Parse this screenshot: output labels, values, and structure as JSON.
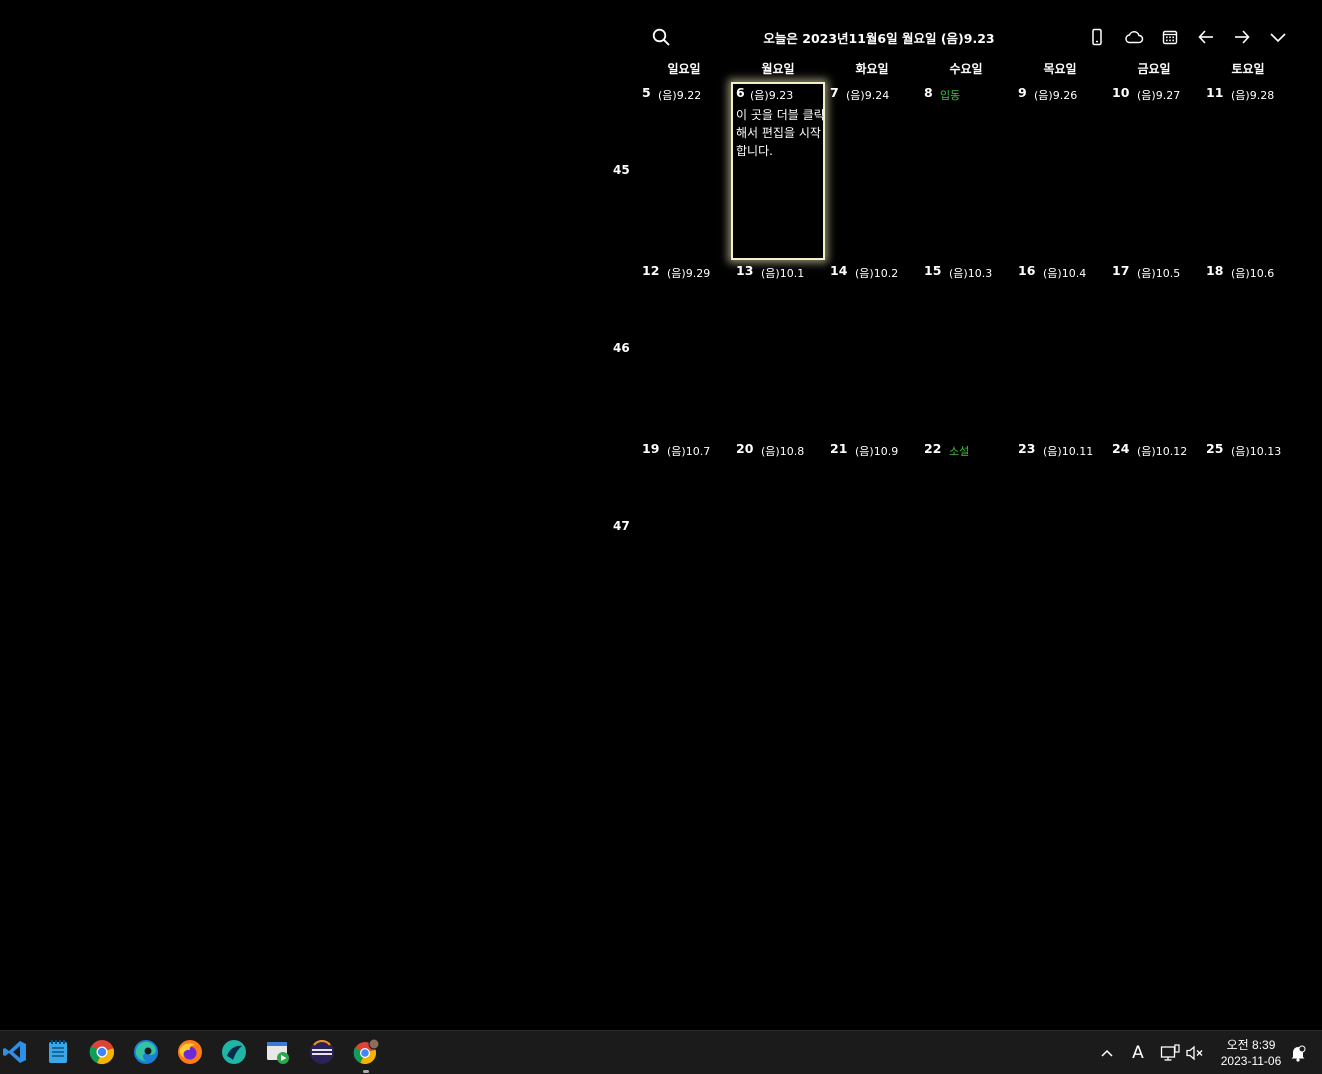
{
  "header": {
    "title": "오늘은 2023년11월6일 월요일 (음)9.23",
    "icons": [
      "search-icon",
      "mobile-icon",
      "cloud-icon",
      "calendar-icon",
      "arrow-left-icon",
      "arrow-right-icon",
      "chevron-down-icon"
    ]
  },
  "weekdays": [
    "일요일",
    "월요일",
    "화요일",
    "수요일",
    "목요일",
    "금요일",
    "토요일"
  ],
  "weeks": [
    {
      "num": "45",
      "days": [
        {
          "day": "5",
          "lunar": "(음)9.22"
        },
        {
          "day": "6",
          "lunar": "(음)9.23",
          "today": true,
          "note": "이 곳을 더블 클릭해서 편집을 시작합니다."
        },
        {
          "day": "7",
          "lunar": "(음)9.24"
        },
        {
          "day": "8",
          "lunar": "입동",
          "term": true
        },
        {
          "day": "9",
          "lunar": "(음)9.26"
        },
        {
          "day": "10",
          "lunar": "(음)9.27"
        },
        {
          "day": "11",
          "lunar": "(음)9.28"
        }
      ]
    },
    {
      "num": "46",
      "days": [
        {
          "day": "12",
          "lunar": "(음)9.29"
        },
        {
          "day": "13",
          "lunar": "(음)10.1"
        },
        {
          "day": "14",
          "lunar": "(음)10.2"
        },
        {
          "day": "15",
          "lunar": "(음)10.3"
        },
        {
          "day": "16",
          "lunar": "(음)10.4"
        },
        {
          "day": "17",
          "lunar": "(음)10.5"
        },
        {
          "day": "18",
          "lunar": "(음)10.6"
        }
      ]
    },
    {
      "num": "47",
      "days": [
        {
          "day": "19",
          "lunar": "(음)10.7"
        },
        {
          "day": "20",
          "lunar": "(음)10.8"
        },
        {
          "day": "21",
          "lunar": "(음)10.9"
        },
        {
          "day": "22",
          "lunar": "소설",
          "term": true
        },
        {
          "day": "23",
          "lunar": "(음)10.11"
        },
        {
          "day": "24",
          "lunar": "(음)10.12"
        },
        {
          "day": "25",
          "lunar": "(음)10.13"
        }
      ]
    }
  ],
  "colors": {
    "background": "#000000",
    "term": "#3fbf3f",
    "today_border": "#f3efc6",
    "taskbar": "#1b1b1b"
  },
  "taskbar": {
    "apps": [
      "vscode-icon",
      "notepad-icon",
      "chrome-icon",
      "edge-icon",
      "firefox-icon",
      "app-icon",
      "media-app-icon",
      "eclipse-icon",
      "chrome-profile-icon"
    ],
    "tray": {
      "ime": "A",
      "time": "오전 8:39",
      "date": "2023-11-06"
    }
  }
}
